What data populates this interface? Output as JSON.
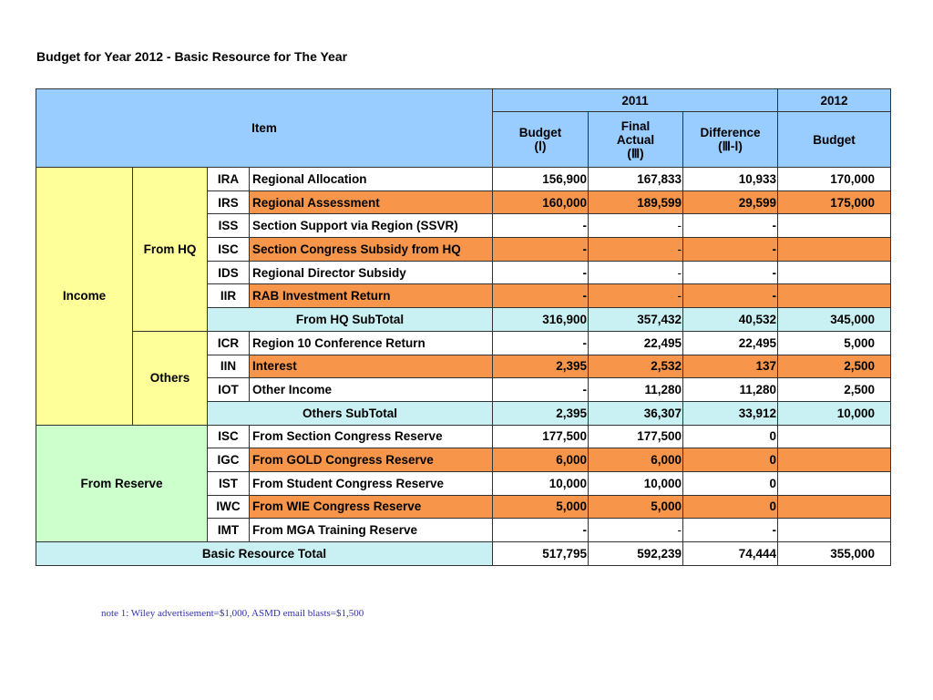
{
  "title": "Budget for Year 2012 - Basic Resource for The Year",
  "header": {
    "item": "Item",
    "year_2011": "2011",
    "year_2012": "2012",
    "budget_2011": "Budget",
    "budget_2011_code": "(Ⅰ)",
    "final_actual_1": "Final",
    "final_actual_2": "Actual",
    "final_actual_code": "(Ⅲ)",
    "difference": "Difference",
    "difference_code": "(Ⅲ-Ⅰ)",
    "budget_2012": "Budget"
  },
  "groups": {
    "income": "Income",
    "from_hq": "From HQ",
    "others": "Others",
    "from_reserve": "From Reserve"
  },
  "rows": [
    {
      "code": "IRA",
      "name": "Regional Allocation",
      "budget2011": "156,900",
      "actual": "167,833",
      "diff": "10,933",
      "budget2012": "170,000"
    },
    {
      "code": "IRS",
      "name": "Regional Assessment",
      "budget2011": "160,000",
      "actual": "189,599",
      "diff": "29,599",
      "budget2012": "175,000"
    },
    {
      "code": "ISS",
      "name": "Section Support via Region (SSVR)",
      "budget2011": "-",
      "actual": "-",
      "diff": "-",
      "budget2012": ""
    },
    {
      "code": "ISC",
      "name": "Section Congress Subsidy from HQ",
      "budget2011": "-",
      "actual": "-",
      "diff": "-",
      "budget2012": ""
    },
    {
      "code": "IDS",
      "name": "Regional Director Subsidy",
      "budget2011": "-",
      "actual": "-",
      "diff": "-",
      "budget2012": ""
    },
    {
      "code": "IIR",
      "name": "RAB Investment Return",
      "budget2011": "-",
      "actual": "-",
      "diff": "-",
      "budget2012": ""
    },
    {
      "code": "ICR",
      "name": "Region 10 Conference Return",
      "budget2011": "-",
      "actual": "22,495",
      "diff": "22,495",
      "budget2012": "5,000"
    },
    {
      "code": "IIN",
      "name": "Interest",
      "budget2011": "2,395",
      "actual": "2,532",
      "diff": "137",
      "budget2012": "2,500"
    },
    {
      "code": "IOT",
      "name": "Other Income",
      "budget2011": "-",
      "actual": "11,280",
      "diff": "11,280",
      "budget2012": "2,500"
    },
    {
      "code": "ISC",
      "name": "From Section Congress Reserve",
      "budget2011": "177,500",
      "actual": "177,500",
      "diff": "0",
      "budget2012": ""
    },
    {
      "code": "IGC",
      "name": "From GOLD Congress Reserve",
      "budget2011": "6,000",
      "actual": "6,000",
      "diff": "0",
      "budget2012": ""
    },
    {
      "code": "IST",
      "name": "From Student Congress Reserve",
      "budget2011": "10,000",
      "actual": "10,000",
      "diff": "0",
      "budget2012": ""
    },
    {
      "code": "IWC",
      "name": "From WIE Congress Reserve",
      "budget2011": "5,000",
      "actual": "5,000",
      "diff": "0",
      "budget2012": ""
    },
    {
      "code": "IMT",
      "name": "From MGA Training Reserve",
      "budget2011": "-",
      "actual": "-",
      "diff": "-",
      "budget2012": ""
    }
  ],
  "subtotals": {
    "hq": {
      "label": "From HQ SubTotal",
      "budget2011": "316,900",
      "actual": "357,432",
      "diff": "40,532",
      "budget2012": "345,000"
    },
    "others": {
      "label": "Others SubTotal",
      "budget2011": "2,395",
      "actual": "36,307",
      "diff": "33,912",
      "budget2012": "10,000"
    },
    "total": {
      "label": "Basic Resource Total",
      "budget2011": "517,795",
      "actual": "592,239",
      "diff": "74,444",
      "budget2012": "355,000"
    }
  },
  "note": "note 1: Wiley advertisement=$1,000, ASMD email blasts=$1,500",
  "colors": {
    "header_blue": "#99ccff",
    "income_yellow": "#ffff99",
    "reserve_green": "#ccffcc",
    "subtotal_cyan": "#c9f0f2",
    "highlight_orange": "#f7964a"
  }
}
